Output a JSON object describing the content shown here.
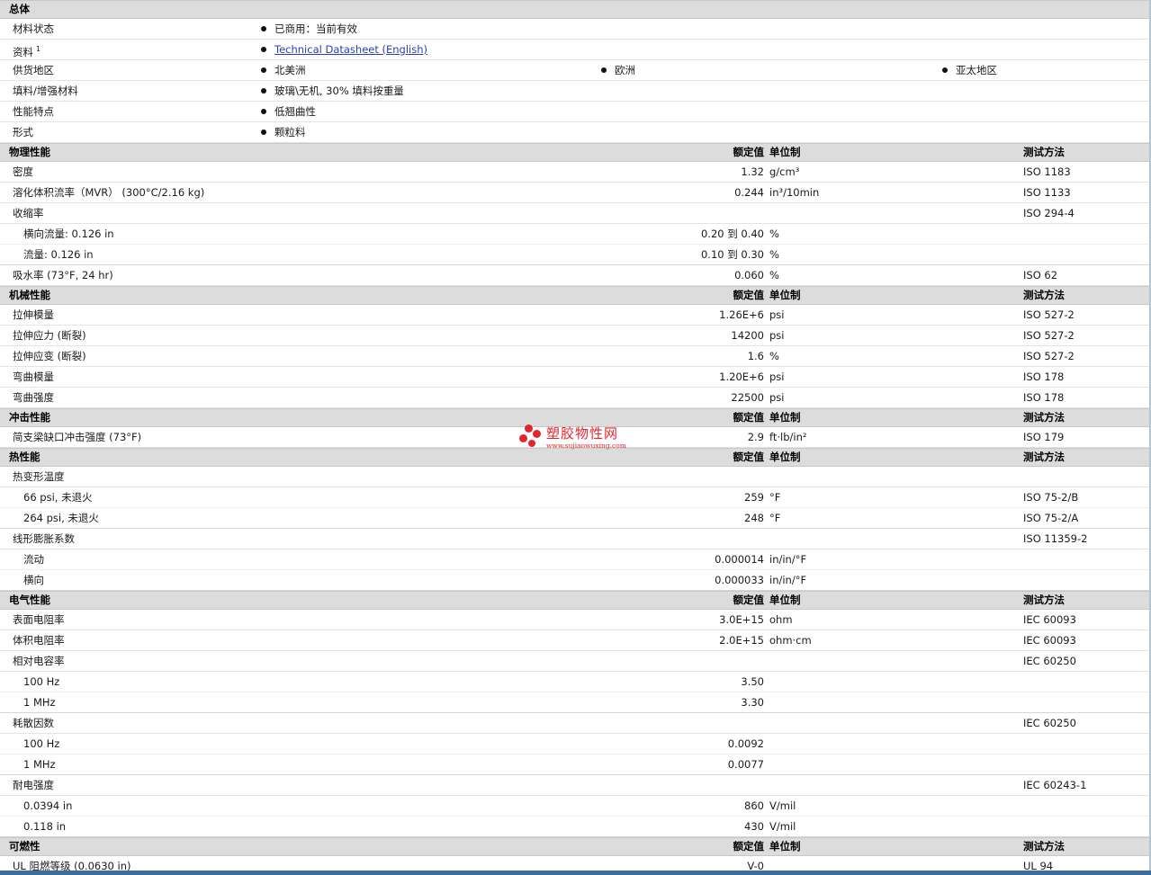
{
  "general": {
    "title": "总体",
    "rows": [
      {
        "label": "材料状态",
        "items": [
          "已商用：当前有效"
        ]
      },
      {
        "label": "资料",
        "sup": "1",
        "items": [
          "Technical Datasheet (English)"
        ],
        "link": true
      },
      {
        "label": "供货地区",
        "items": [
          "北美洲",
          "欧洲",
          "亚太地区"
        ]
      },
      {
        "label": "填料/增强材料",
        "items": [
          "玻璃\\无机, 30% 填料按重量"
        ]
      },
      {
        "label": "性能特点",
        "items": [
          "低翘曲性"
        ]
      },
      {
        "label": "形式",
        "items": [
          "颗粒料"
        ]
      }
    ]
  },
  "headers": {
    "value": "额定值",
    "unit": "单位制",
    "test": "测试方法"
  },
  "sections": [
    {
      "title": "物理性能",
      "rows": [
        {
          "label": "密度",
          "value": "1.32",
          "unit": "g/cm³",
          "test": "ISO 1183"
        },
        {
          "label": "溶化体积流率（MVR） (300°C/2.16 kg)",
          "value": "0.244",
          "unit": "in³/10min",
          "test": "ISO 1133"
        },
        {
          "label": "收缩率",
          "value": "",
          "unit": "",
          "test": "ISO 294-4"
        },
        {
          "label": "横向流量: 0.126 in",
          "value": "0.20 到 0.40",
          "unit": "%",
          "test": "",
          "sub": true
        },
        {
          "label": "流量: 0.126 in",
          "value": "0.10 到 0.30",
          "unit": "%",
          "test": "",
          "sub": true,
          "last": true
        },
        {
          "label": "吸水率 (73°F, 24 hr)",
          "value": "0.060",
          "unit": "%",
          "test": "ISO 62"
        }
      ]
    },
    {
      "title": "机械性能",
      "rows": [
        {
          "label": "拉伸模量",
          "value": "1.26E+6",
          "unit": "psi",
          "test": "ISO 527-2"
        },
        {
          "label": "拉伸应力 (断裂)",
          "value": "14200",
          "unit": "psi",
          "test": "ISO 527-2"
        },
        {
          "label": "拉伸应变 (断裂)",
          "value": "1.6",
          "unit": "%",
          "test": "ISO 527-2"
        },
        {
          "label": "弯曲模量",
          "value": "1.20E+6",
          "unit": "psi",
          "test": "ISO 178"
        },
        {
          "label": "弯曲强度",
          "value": "22500",
          "unit": "psi",
          "test": "ISO 178"
        }
      ]
    },
    {
      "title": "冲击性能",
      "rows": [
        {
          "label": "简支梁缺口冲击强度 (73°F)",
          "value": "2.9",
          "unit": "ft·lb/in²",
          "test": "ISO 179"
        }
      ]
    },
    {
      "title": "热性能",
      "rows": [
        {
          "label": "热变形温度",
          "value": "",
          "unit": "",
          "test": ""
        },
        {
          "label": "66 psi, 未退火",
          "value": "259",
          "unit": "°F",
          "test": "ISO 75-2/B",
          "sub": true
        },
        {
          "label": "264 psi, 未退火",
          "value": "248",
          "unit": "°F",
          "test": "ISO 75-2/A",
          "sub": true,
          "last": true
        },
        {
          "label": "线形膨胀系数",
          "value": "",
          "unit": "",
          "test": "ISO 11359-2"
        },
        {
          "label": "流动",
          "value": "0.000014",
          "unit": "in/in/°F",
          "test": "",
          "sub": true
        },
        {
          "label": "横向",
          "value": "0.000033",
          "unit": "in/in/°F",
          "test": "",
          "sub": true,
          "last": true
        }
      ]
    },
    {
      "title": "电气性能",
      "rows": [
        {
          "label": "表面电阻率",
          "value": "3.0E+15",
          "unit": "ohm",
          "test": "IEC 60093"
        },
        {
          "label": "体积电阻率",
          "value": "2.0E+15",
          "unit": "ohm·cm",
          "test": "IEC 60093"
        },
        {
          "label": "相对电容率",
          "value": "",
          "unit": "",
          "test": "IEC 60250"
        },
        {
          "label": "100 Hz",
          "value": "3.50",
          "unit": "",
          "test": "",
          "sub": true
        },
        {
          "label": "1 MHz",
          "value": "3.30",
          "unit": "",
          "test": "",
          "sub": true,
          "last": true
        },
        {
          "label": "耗散因数",
          "value": "",
          "unit": "",
          "test": "IEC 60250"
        },
        {
          "label": "100 Hz",
          "value": "0.0092",
          "unit": "",
          "test": "",
          "sub": true
        },
        {
          "label": "1 MHz",
          "value": "0.0077",
          "unit": "",
          "test": "",
          "sub": true,
          "last": true
        },
        {
          "label": "耐电强度",
          "value": "",
          "unit": "",
          "test": "IEC 60243-1"
        },
        {
          "label": "0.0394 in",
          "value": "860",
          "unit": "V/mil",
          "test": "",
          "sub": true
        },
        {
          "label": "0.118 in",
          "value": "430",
          "unit": "V/mil",
          "test": "",
          "sub": true,
          "last": true
        }
      ]
    },
    {
      "title": "可燃性",
      "rows": [
        {
          "label": "UL 阻燃等级 (0.0630 in)",
          "value": "V-0",
          "unit": "",
          "test": "UL 94"
        }
      ]
    }
  ],
  "watermark": {
    "name": "塑胶物性网",
    "url": "www.sujiaowuxing.com"
  },
  "colors": {
    "section_bg": "#dcdcdc",
    "link": "#2a3fb0",
    "watermark": "#e3262e",
    "bottom_bar": "#3f6d9a"
  }
}
